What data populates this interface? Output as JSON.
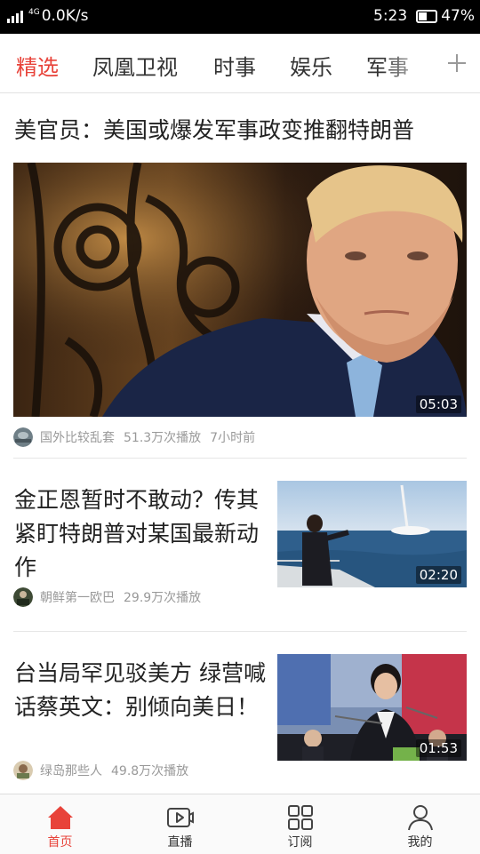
{
  "status_bar": {
    "network": "4G",
    "speed": "0.0K/s",
    "time": "5:23",
    "battery": "47%"
  },
  "tabs": [
    {
      "label": "精选",
      "active": true
    },
    {
      "label": "凤凰卫视"
    },
    {
      "label": "时事"
    },
    {
      "label": "娱乐"
    },
    {
      "label": "军事"
    }
  ],
  "add_channel_icon": "plus-icon",
  "feed": {
    "featured": {
      "title": "美官员：美国或爆发军事政变推翻特朗普",
      "duration": "05:03",
      "source": "国外比较乱套",
      "plays": "51.3万次播放",
      "time": "7小时前"
    },
    "items": [
      {
        "title": "金正恩暂时不敢动？传其紧盯特朗普对某国最新动作",
        "duration": "02:20",
        "source": "朝鲜第一欧巴",
        "plays": "29.9万次播放"
      },
      {
        "title": "台当局罕见驳美方 绿营喊话蔡英文：别倾向美日！",
        "duration": "01:53",
        "source": "绿岛那些人",
        "plays": "49.8万次播放"
      }
    ]
  },
  "bottom_nav": [
    {
      "label": "首页",
      "icon": "home-icon",
      "active": true
    },
    {
      "label": "直播",
      "icon": "live-icon"
    },
    {
      "label": "订阅",
      "icon": "subscribe-icon"
    },
    {
      "label": "我的",
      "icon": "profile-icon"
    }
  ],
  "colors": {
    "accent": "#e8433a",
    "text": "#222222",
    "meta": "#999999"
  }
}
